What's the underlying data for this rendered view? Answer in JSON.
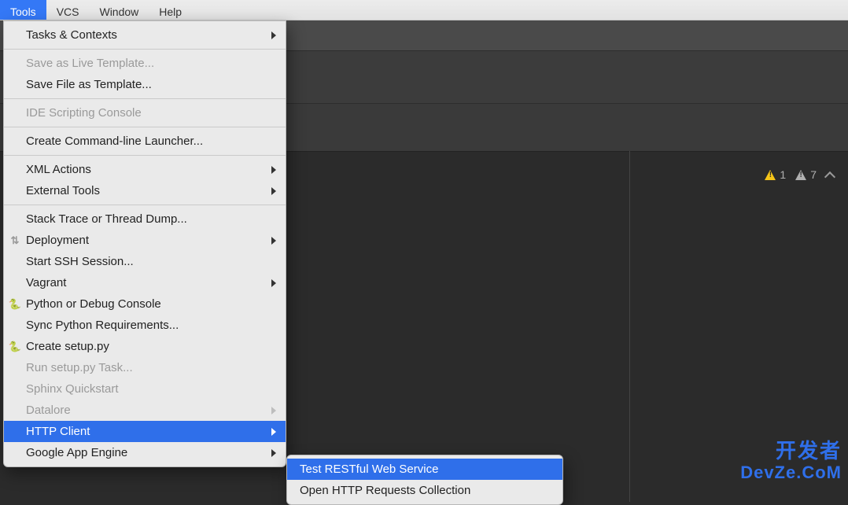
{
  "menubar": {
    "items": [
      {
        "label": "Tools",
        "selected": true
      },
      {
        "label": "VCS"
      },
      {
        "label": "Window"
      },
      {
        "label": "Help"
      }
    ]
  },
  "tools_menu": {
    "groups": [
      [
        {
          "label": "Tasks & Contexts",
          "submenu": true
        }
      ],
      [
        {
          "label": "Save as Live Template...",
          "disabled": true
        },
        {
          "label": "Save File as Template..."
        }
      ],
      [
        {
          "label": "IDE Scripting Console",
          "disabled": true
        }
      ],
      [
        {
          "label": "Create Command-line Launcher..."
        }
      ],
      [
        {
          "label": "XML Actions",
          "submenu": true
        },
        {
          "label": "External Tools",
          "submenu": true
        }
      ],
      [
        {
          "label": "Stack Trace or Thread Dump..."
        },
        {
          "label": "Deployment",
          "submenu": true,
          "icon": "deploy-icon"
        },
        {
          "label": "Start SSH Session..."
        },
        {
          "label": "Vagrant",
          "submenu": true
        },
        {
          "label": "Python or Debug Console",
          "icon": "python-icon"
        },
        {
          "label": "Sync Python Requirements..."
        },
        {
          "label": "Create setup.py",
          "icon": "python-icon"
        },
        {
          "label": "Run setup.py Task...",
          "disabled": true
        },
        {
          "label": "Sphinx Quickstart",
          "disabled": true
        },
        {
          "label": "Datalore",
          "submenu": true,
          "disabled": true
        },
        {
          "label": "HTTP Client",
          "submenu": true,
          "selected": true
        },
        {
          "label": "Google App Engine",
          "submenu": true
        }
      ]
    ]
  },
  "http_client_submenu": {
    "items": [
      {
        "label": "Test RESTful Web Service",
        "selected": true
      },
      {
        "label": "Open HTTP Requests Collection"
      }
    ]
  },
  "editor": {
    "warnings": {
      "yellow_count": "1",
      "gray_count": "7"
    }
  },
  "watermark": {
    "line1": "开发者",
    "line2": "DevZe.CoM"
  }
}
